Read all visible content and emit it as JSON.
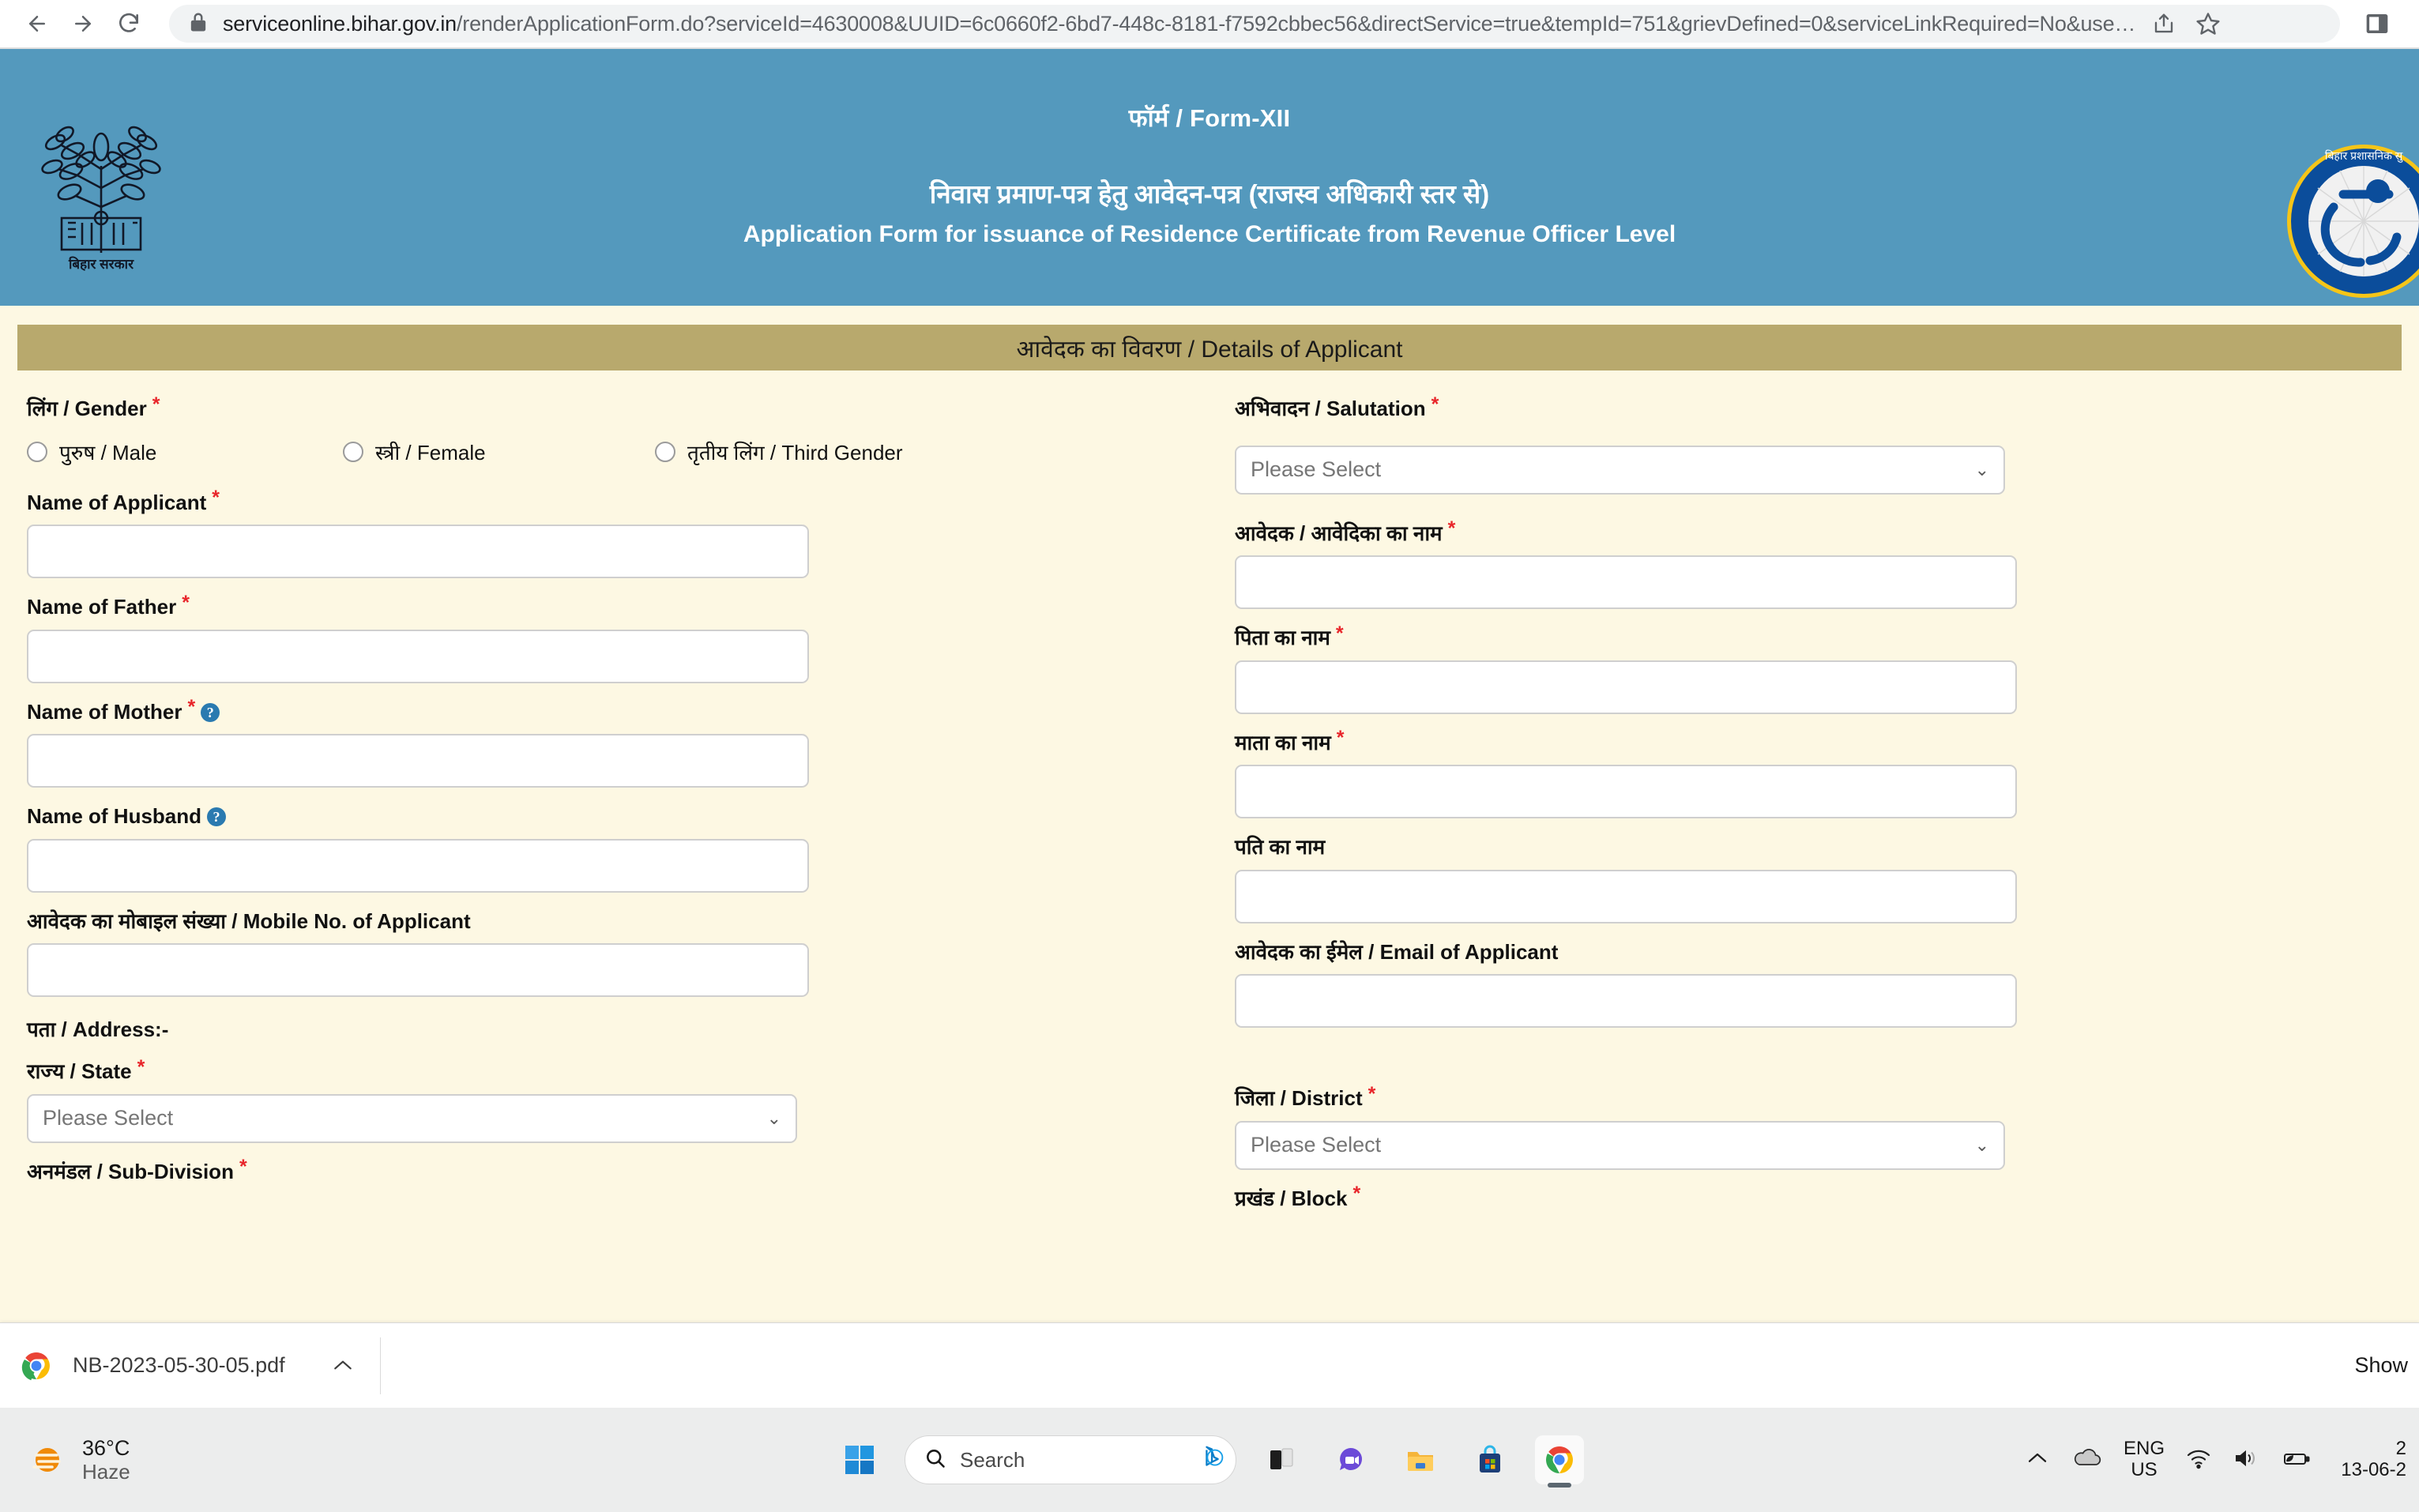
{
  "browser": {
    "url_host": "serviceonline.bihar.gov.in",
    "url_path": "/renderApplicationForm.do?serviceId=4630008&UUID=6c0660f2-6bd7-448c-8181-f7592cbbec56&directService=true&tempId=751&grievDefined=0&serviceLinkRequired=No&use…",
    "back_icon": "back-arrow-icon",
    "forward_icon": "forward-arrow-icon",
    "reload_icon": "reload-icon",
    "lock_icon": "lock-icon",
    "share_icon": "share-icon",
    "bookmark_icon": "star-icon",
    "sidepanel_icon": "side-panel-icon"
  },
  "banner": {
    "form_no": "फॉर्म / Form-XII",
    "title_hi": "निवास प्रमाण-पत्र हेतु आवेदन-पत्र (राजस्व अधिकारी स्तर से)",
    "title_en": "Application Form for issuance of  Residence Certificate from Revenue Officer Level",
    "emblem_icon": "bihar-government-emblem",
    "logo_icon": "bihar-prashasnik-sudhar-logo",
    "bg_color": "#5499bd"
  },
  "section": {
    "header": "आवेदक का विवरण / Details of Applicant",
    "header_bg": "#b8a96d"
  },
  "form": {
    "gender": {
      "label": "लिंग / Gender",
      "required": "*",
      "options": [
        {
          "label": "पुरुष / Male",
          "selected": false
        },
        {
          "label": "स्त्री / Female",
          "selected": false
        },
        {
          "label": "तृतीय लिंग / Third Gender",
          "selected": false
        }
      ]
    },
    "salutation": {
      "label": "अभिवादन / Salutation",
      "required": "*",
      "value": "Please Select"
    },
    "name_applicant_en": {
      "label": "Name of Applicant",
      "required": "*",
      "value": ""
    },
    "name_applicant_hi": {
      "label": "आवेदक / आवेदिका का नाम",
      "required": "*",
      "value": ""
    },
    "name_father_en": {
      "label": "Name of Father",
      "required": "*",
      "value": ""
    },
    "name_father_hi": {
      "label": "पिता का नाम",
      "required": "*",
      "value": ""
    },
    "name_mother_en": {
      "label": "Name of Mother",
      "required": "*",
      "help": "?",
      "value": ""
    },
    "name_mother_hi": {
      "label": "माता का नाम",
      "required": "*",
      "value": ""
    },
    "name_husband_en": {
      "label": "Name of Husband",
      "help": "?",
      "value": ""
    },
    "name_husband_hi": {
      "label": "पति का नाम",
      "value": ""
    },
    "mobile": {
      "label": "आवेदक का मोबाइल संख्या / Mobile No. of Applicant",
      "value": ""
    },
    "email": {
      "label": "आवेदक का ईमेल / Email of Applicant",
      "value": ""
    },
    "address_heading": "पता / Address:-",
    "state": {
      "label": "राज्य / State",
      "required": "*",
      "value": "Please Select"
    },
    "district": {
      "label": "जिला / District",
      "required": "*",
      "value": "Please Select"
    },
    "subdivision": {
      "label": "अनमंडल / Sub-Division",
      "required": "*"
    },
    "block": {
      "label": "प्रखंड / Block",
      "required": "*"
    }
  },
  "download_shelf": {
    "file_name": "NB-2023-05-30-05.pdf",
    "file_icon": "chrome-pdf-icon",
    "caret_icon": "chevron-up-icon",
    "show_all_label": "Show"
  },
  "taskbar": {
    "weather_temp": "36°C",
    "weather_desc": "Haze",
    "weather_icon": "haze-sun-icon",
    "start_icon": "windows-start-icon",
    "search_placeholder": "Search",
    "search_icon": "search-icon",
    "bing_icon": "bing-chat-icon",
    "apps": [
      {
        "name": "task-view-icon"
      },
      {
        "name": "teams-chat-icon"
      },
      {
        "name": "file-explorer-icon"
      },
      {
        "name": "microsoft-store-icon"
      },
      {
        "name": "google-chrome-icon"
      }
    ],
    "tray_chevron": "▲",
    "onedrive_icon": "onedrive-cloud-icon",
    "language": "ENG",
    "language_region": "US",
    "wifi_icon": "wifi-icon",
    "volume_icon": "volume-icon",
    "battery_icon": "battery-eco-icon",
    "time": "2",
    "date": "13-06-2"
  }
}
